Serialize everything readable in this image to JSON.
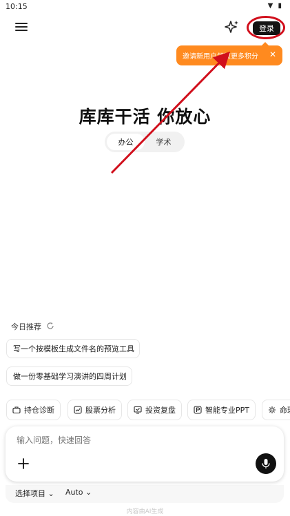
{
  "status_bar": {
    "time": "10:15",
    "icons": [
      "wifi-icon",
      "battery-icon"
    ]
  },
  "header": {
    "menu_icon": "menu-icon",
    "sparkle_icon": "sparkle-icon",
    "login_label": "登录"
  },
  "tooltip": {
    "text": "邀请新用户领取更多积分",
    "close": "✕"
  },
  "hero": {
    "title": "库库干活 你放心",
    "modes": [
      "办公",
      "学术"
    ],
    "active_mode": "办公"
  },
  "recommend": {
    "title": "今日推荐",
    "items": [
      "写一个按模板生成文件名的预览工具",
      "做一份零基础学习演讲的四周计划"
    ]
  },
  "tools": [
    {
      "label": "持仓诊断",
      "icon": "briefcase-icon"
    },
    {
      "label": "股票分析",
      "icon": "chart-icon"
    },
    {
      "label": "投资复盘",
      "icon": "review-icon"
    },
    {
      "label": "智能专业PPT",
      "icon": "ppt-icon"
    },
    {
      "label": "命理",
      "icon": "gear-icon"
    }
  ],
  "composer": {
    "placeholder": "输入问题，快速回答",
    "project_select": "选择项目",
    "model_select": "Auto"
  },
  "footer": {
    "note": "内容由AI生成"
  },
  "colors": {
    "accent": "#ff8a1f",
    "annotation": "#d10f1c",
    "primary_button": "#141414"
  }
}
